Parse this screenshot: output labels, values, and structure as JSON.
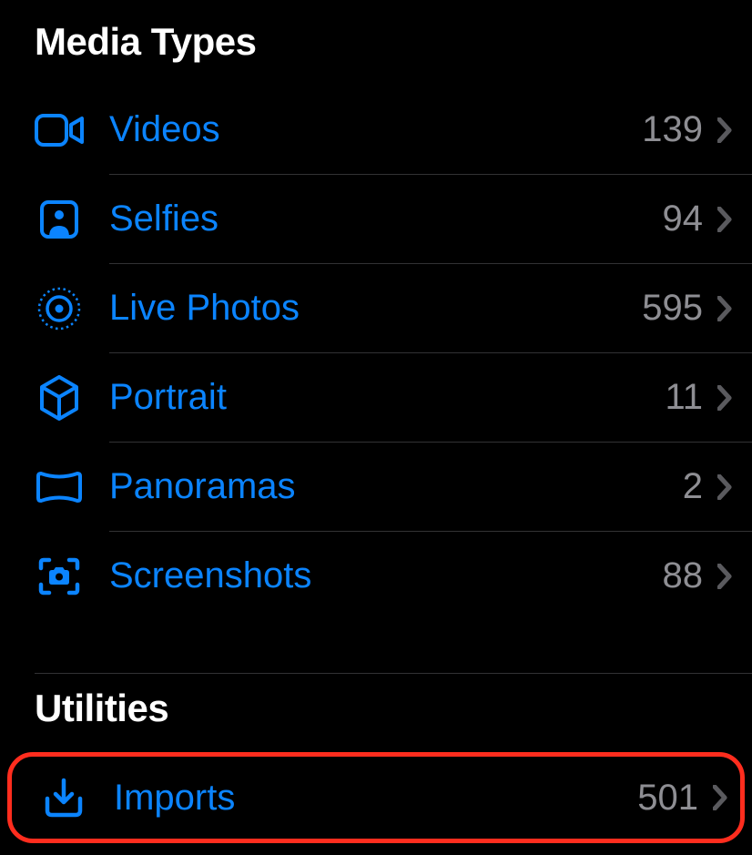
{
  "sections": {
    "media_types": {
      "title": "Media Types",
      "items": [
        {
          "icon": "video",
          "label": "Videos",
          "count": "139"
        },
        {
          "icon": "selfie",
          "label": "Selfies",
          "count": "94"
        },
        {
          "icon": "live-photo",
          "label": "Live Photos",
          "count": "595"
        },
        {
          "icon": "portrait",
          "label": "Portrait",
          "count": "11"
        },
        {
          "icon": "panorama",
          "label": "Panoramas",
          "count": "2"
        },
        {
          "icon": "screenshot",
          "label": "Screenshots",
          "count": "88"
        }
      ]
    },
    "utilities": {
      "title": "Utilities",
      "items": [
        {
          "icon": "import",
          "label": "Imports",
          "count": "501"
        }
      ]
    }
  },
  "colors": {
    "accent": "#0B84FF",
    "highlight": "#FF2D1E",
    "secondary": "#8E8E93"
  }
}
